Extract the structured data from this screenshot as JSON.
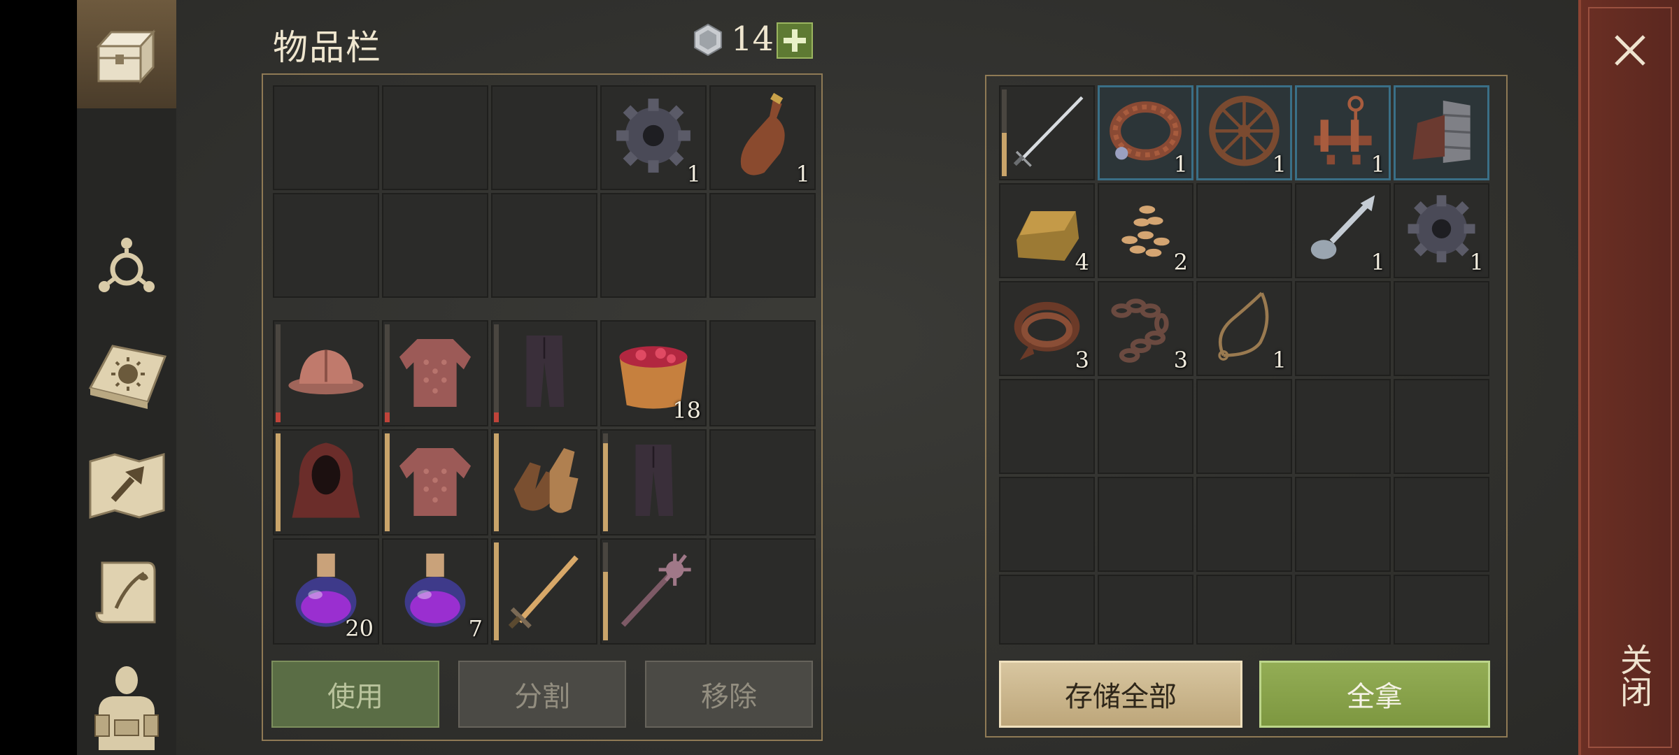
{
  "header": {
    "title": "物品栏",
    "currency_count": "14",
    "plus_label": "+"
  },
  "sidebar": {
    "tabs": [
      "chest-icon",
      "skills-icon",
      "sun-book-icon",
      "map-icon",
      "scroll-icon",
      "character-icon"
    ]
  },
  "inventory": {
    "top_rows": [
      [
        null,
        null,
        null,
        {
          "item": "gear",
          "count": "1"
        },
        {
          "item": "bottle",
          "count": "1"
        }
      ],
      [
        null,
        null,
        null,
        null,
        null
      ]
    ],
    "bottom_rows": [
      [
        {
          "item": "helmet",
          "dur": 0.1,
          "dur_color": "red"
        },
        {
          "item": "chainmail",
          "dur": 0.1,
          "dur_color": "red"
        },
        {
          "item": "pants",
          "dur": 0.1,
          "dur_color": "red"
        },
        {
          "item": "berry-bowl",
          "count": "18"
        },
        null
      ],
      [
        {
          "item": "hood",
          "dur": 1.0
        },
        {
          "item": "chainmail",
          "dur": 1.0
        },
        {
          "item": "gloves",
          "dur": 1.0
        },
        {
          "item": "pants",
          "dur": 0.9
        },
        null
      ],
      [
        {
          "item": "potion",
          "count": "20"
        },
        {
          "item": "potion",
          "count": "7"
        },
        {
          "item": "sword",
          "dur": 1.0
        },
        {
          "item": "mace",
          "dur": 0.7
        },
        null
      ]
    ],
    "buttons": {
      "use": "使用",
      "split": "分割",
      "remove": "移除"
    }
  },
  "container": {
    "rows": [
      [
        {
          "item": "katana",
          "dur": 0.5
        },
        {
          "item": "collar",
          "count": "1",
          "blue": true
        },
        {
          "item": "wheel",
          "count": "1",
          "blue": true
        },
        {
          "item": "contraption",
          "count": "1",
          "blue": true
        },
        {
          "item": "arm-guard",
          "blue": true
        }
      ],
      [
        {
          "item": "ingot",
          "count": "4"
        },
        {
          "item": "seeds",
          "count": "2"
        },
        null,
        {
          "item": "spoon",
          "count": "1"
        },
        {
          "item": "gear",
          "count": "1"
        }
      ],
      [
        {
          "item": "leather",
          "count": "3"
        },
        {
          "item": "chain",
          "count": "3"
        },
        {
          "item": "rope",
          "count": "1"
        },
        null,
        null
      ],
      [
        null,
        null,
        null,
        null,
        null
      ],
      [
        null,
        null,
        null,
        null,
        null
      ],
      [
        null,
        null,
        null,
        null,
        null
      ]
    ],
    "buttons": {
      "store_all": "存储全部",
      "take_all": "全拿"
    }
  },
  "close": {
    "label": "关闭"
  },
  "colors": {
    "accent_green": "#7d9740",
    "frame": "#8f7a55",
    "close_panel": "#6b2f24"
  }
}
